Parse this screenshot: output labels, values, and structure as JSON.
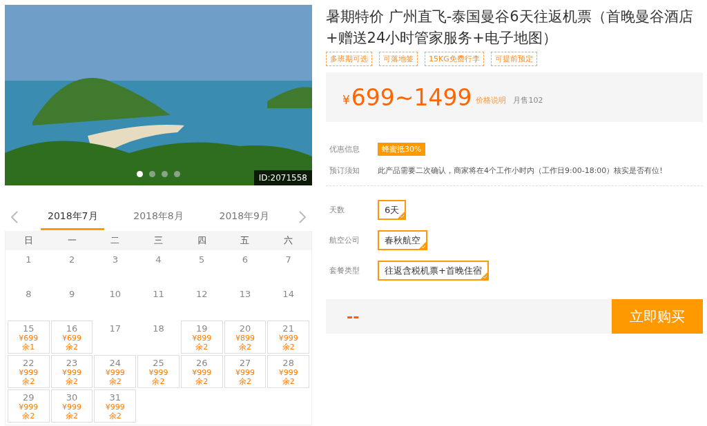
{
  "gallery": {
    "slides": [
      {
        "selected": true
      },
      {
        "selected": false
      },
      {
        "selected": false
      },
      {
        "selected": false
      }
    ],
    "id_badge": "ID:2071558"
  },
  "calendar": {
    "months": [
      {
        "label": "2018年7月",
        "selected": true
      },
      {
        "label": "2018年8月",
        "selected": false
      },
      {
        "label": "2018年9月",
        "selected": false
      }
    ],
    "weekdays": [
      "日",
      "一",
      "二",
      "三",
      "四",
      "五",
      "六"
    ],
    "weeks": [
      [
        {
          "day": "1"
        },
        {
          "day": "2"
        },
        {
          "day": "3"
        },
        {
          "day": "4"
        },
        {
          "day": "5"
        },
        {
          "day": "6"
        },
        {
          "day": "7"
        }
      ],
      [
        {
          "day": "8"
        },
        {
          "day": "9"
        },
        {
          "day": "10"
        },
        {
          "day": "11"
        },
        {
          "day": "12"
        },
        {
          "day": "13"
        },
        {
          "day": "14"
        }
      ],
      [
        {
          "day": "15",
          "price": "¥699",
          "remaining": "余1"
        },
        {
          "day": "16",
          "price": "¥699",
          "remaining": "余2"
        },
        {
          "day": "17"
        },
        {
          "day": "18"
        },
        {
          "day": "19",
          "price": "¥899",
          "remaining": "余2"
        },
        {
          "day": "20",
          "price": "¥899",
          "remaining": "余2"
        },
        {
          "day": "21",
          "price": "¥999",
          "remaining": "余2"
        }
      ],
      [
        {
          "day": "22",
          "price": "¥999",
          "remaining": "余2"
        },
        {
          "day": "23",
          "price": "¥999",
          "remaining": "余2"
        },
        {
          "day": "24",
          "price": "¥999",
          "remaining": "余2"
        },
        {
          "day": "25",
          "price": "¥999",
          "remaining": "余2"
        },
        {
          "day": "26",
          "price": "¥999",
          "remaining": "余2"
        },
        {
          "day": "27",
          "price": "¥999",
          "remaining": "余2"
        },
        {
          "day": "28",
          "price": "¥999",
          "remaining": "余2"
        }
      ],
      [
        {
          "day": "29",
          "price": "¥999",
          "remaining": "余2"
        },
        {
          "day": "30",
          "price": "¥999",
          "remaining": "余2"
        },
        {
          "day": "31",
          "price": "¥999",
          "remaining": "余2"
        }
      ]
    ]
  },
  "product": {
    "title": "暑期特价 广州直飞-泰国曼谷6天往返机票（首晚曼谷酒店+赠送24小时管家服务+电子地图）",
    "tags": [
      "多班期可选",
      "可落地签",
      "15KG免费行李",
      "可提前预定"
    ],
    "price": {
      "currency": "¥",
      "range": "699~1499",
      "note_link": "价格说明",
      "monthly_sales": "月售102"
    },
    "info": [
      {
        "label": "优惠信息",
        "kind": "badge",
        "value": "蜂蜜抵30%"
      },
      {
        "label": "预订须知",
        "kind": "text",
        "value": "此产品需要二次确认，商家将在4个工作小时内（工作日9:00-18:00）核实是否有位!"
      }
    ],
    "options": [
      {
        "label": "天数",
        "choices": [
          {
            "label": "6天",
            "selected": true
          }
        ]
      },
      {
        "label": "航空公司",
        "choices": [
          {
            "label": "春秋航空",
            "selected": true
          }
        ]
      },
      {
        "label": "套餐类型",
        "choices": [
          {
            "label": "往返含税机票+首晚住宿",
            "selected": true
          }
        ]
      }
    ],
    "total": "--",
    "buy_button": "立即购买"
  }
}
